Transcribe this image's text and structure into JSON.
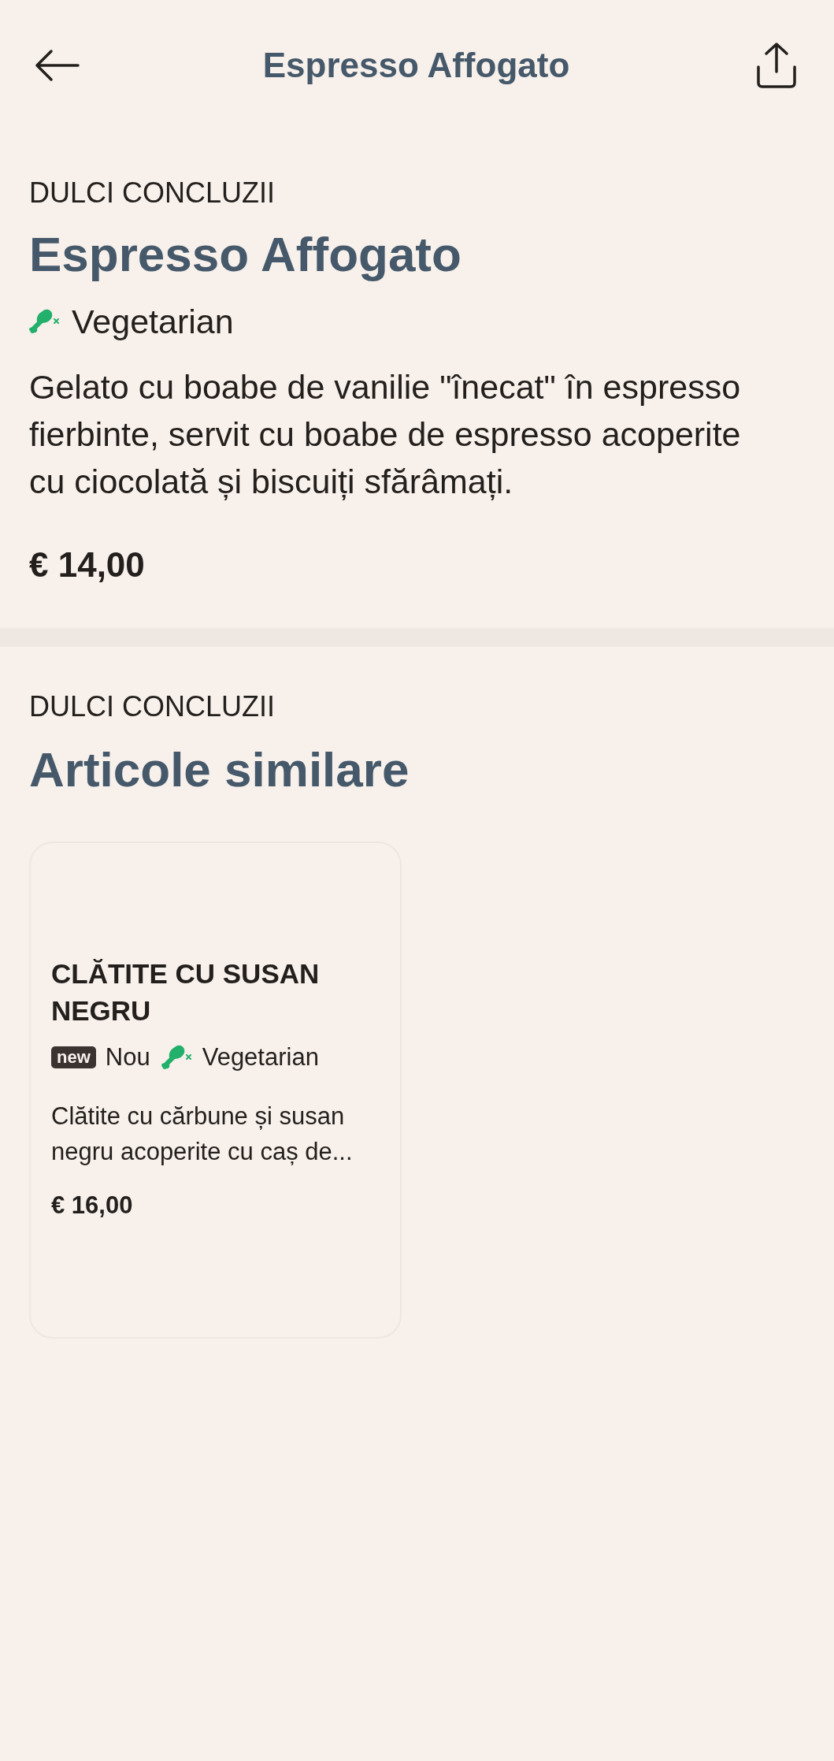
{
  "header": {
    "title": "Espresso Affogato"
  },
  "product": {
    "category": "DULCI CONCLUZII",
    "name": "Espresso Affogato",
    "tags": [
      {
        "kind": "diet",
        "label": "Vegetarian"
      }
    ],
    "description": "Gelato cu boabe de vanilie \"înecat\" în espresso fierbinte, servit cu boabe de espresso acoperite cu ciocolată și biscuiți sfărâmați.",
    "price": "€ 14,00"
  },
  "similar": {
    "category": "DULCI CONCLUZII",
    "title": "Articole similare",
    "items": [
      {
        "name": "CLĂTITE CU SUSAN NEGRU",
        "tags": [
          {
            "kind": "new",
            "badge": "new",
            "label": "Nou"
          },
          {
            "kind": "diet",
            "label": "Vegetarian"
          }
        ],
        "description": "Clătite cu cărbune și susan negru acoperite cu caș de...",
        "price": "€ 16,00"
      }
    ]
  }
}
